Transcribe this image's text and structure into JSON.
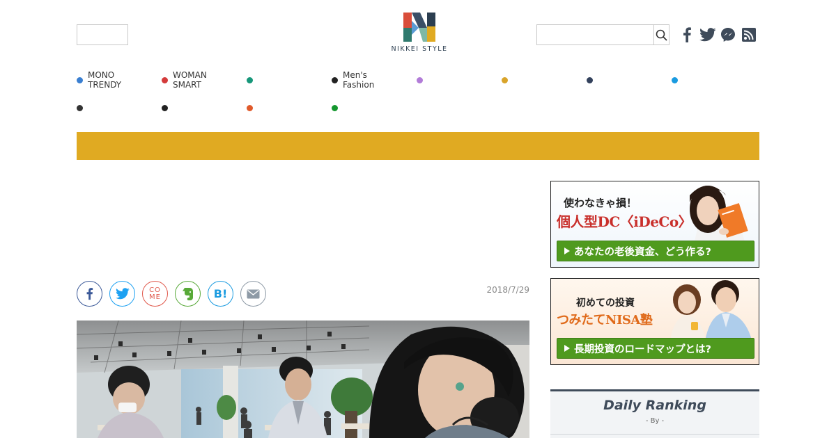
{
  "brand": {
    "logo_text": "NIKKEI STYLE"
  },
  "search": {
    "placeholder": "",
    "button_icon": "search-icon"
  },
  "social_links": [
    {
      "name": "facebook",
      "icon": "facebook-icon"
    },
    {
      "name": "twitter",
      "icon": "twitter-icon"
    },
    {
      "name": "messenger",
      "icon": "messenger-icon"
    },
    {
      "name": "rss",
      "icon": "rss-icon"
    }
  ],
  "nav": {
    "row1": [
      {
        "label": "MONO\nTRENDY",
        "color": "#3a7fd1"
      },
      {
        "label": "WOMAN\nSMART",
        "color": "#d43b3b"
      },
      {
        "label": "",
        "color": "#17977a"
      },
      {
        "label": "Men's\nFashion",
        "color": "#222222"
      },
      {
        "label": "",
        "color": "#b27cd8"
      },
      {
        "label": "",
        "color": "#d9a42a"
      },
      {
        "label": "",
        "color": "#33415c"
      },
      {
        "label": "",
        "color": "#1a9be0"
      }
    ],
    "row2": [
      {
        "label": "",
        "color": "#333333"
      },
      {
        "label": "",
        "color": "#222222"
      },
      {
        "label": "",
        "color": "#e05a2b"
      },
      {
        "label": "",
        "color": "#14972e"
      }
    ]
  },
  "category_bar_color": "#e0aa22",
  "article": {
    "date": "2018/7/29",
    "share_buttons": [
      {
        "name": "facebook",
        "color": "#3b5998",
        "icon": "facebook-icon"
      },
      {
        "name": "twitter",
        "color": "#1da1f2",
        "icon": "twitter-icon"
      },
      {
        "name": "come",
        "color": "#e0584b",
        "icon": "come-icon"
      },
      {
        "name": "evernote",
        "color": "#58a938",
        "icon": "evernote-icon"
      },
      {
        "name": "hatena",
        "color": "#1a9be0",
        "icon": "hatena-bookmark-icon",
        "label": "B!"
      },
      {
        "name": "mail",
        "color": "#8e9aa6",
        "icon": "mail-icon"
      }
    ],
    "share_text": {
      "come_top": "CO",
      "come_bottom": "ME",
      "hatena": "B!"
    }
  },
  "ads": [
    {
      "headline": "使わなきゃ損！",
      "subheadline": "個人型DC〈iDeCo〉",
      "button": "あなたの老後資金、どう作る?"
    },
    {
      "headline": "初めての投資",
      "subheadline": "つみたてNISA塾",
      "button": "長期投資のロードマップとは?"
    }
  ],
  "ranking": {
    "title": "Daily Ranking",
    "by": "- By  -"
  }
}
